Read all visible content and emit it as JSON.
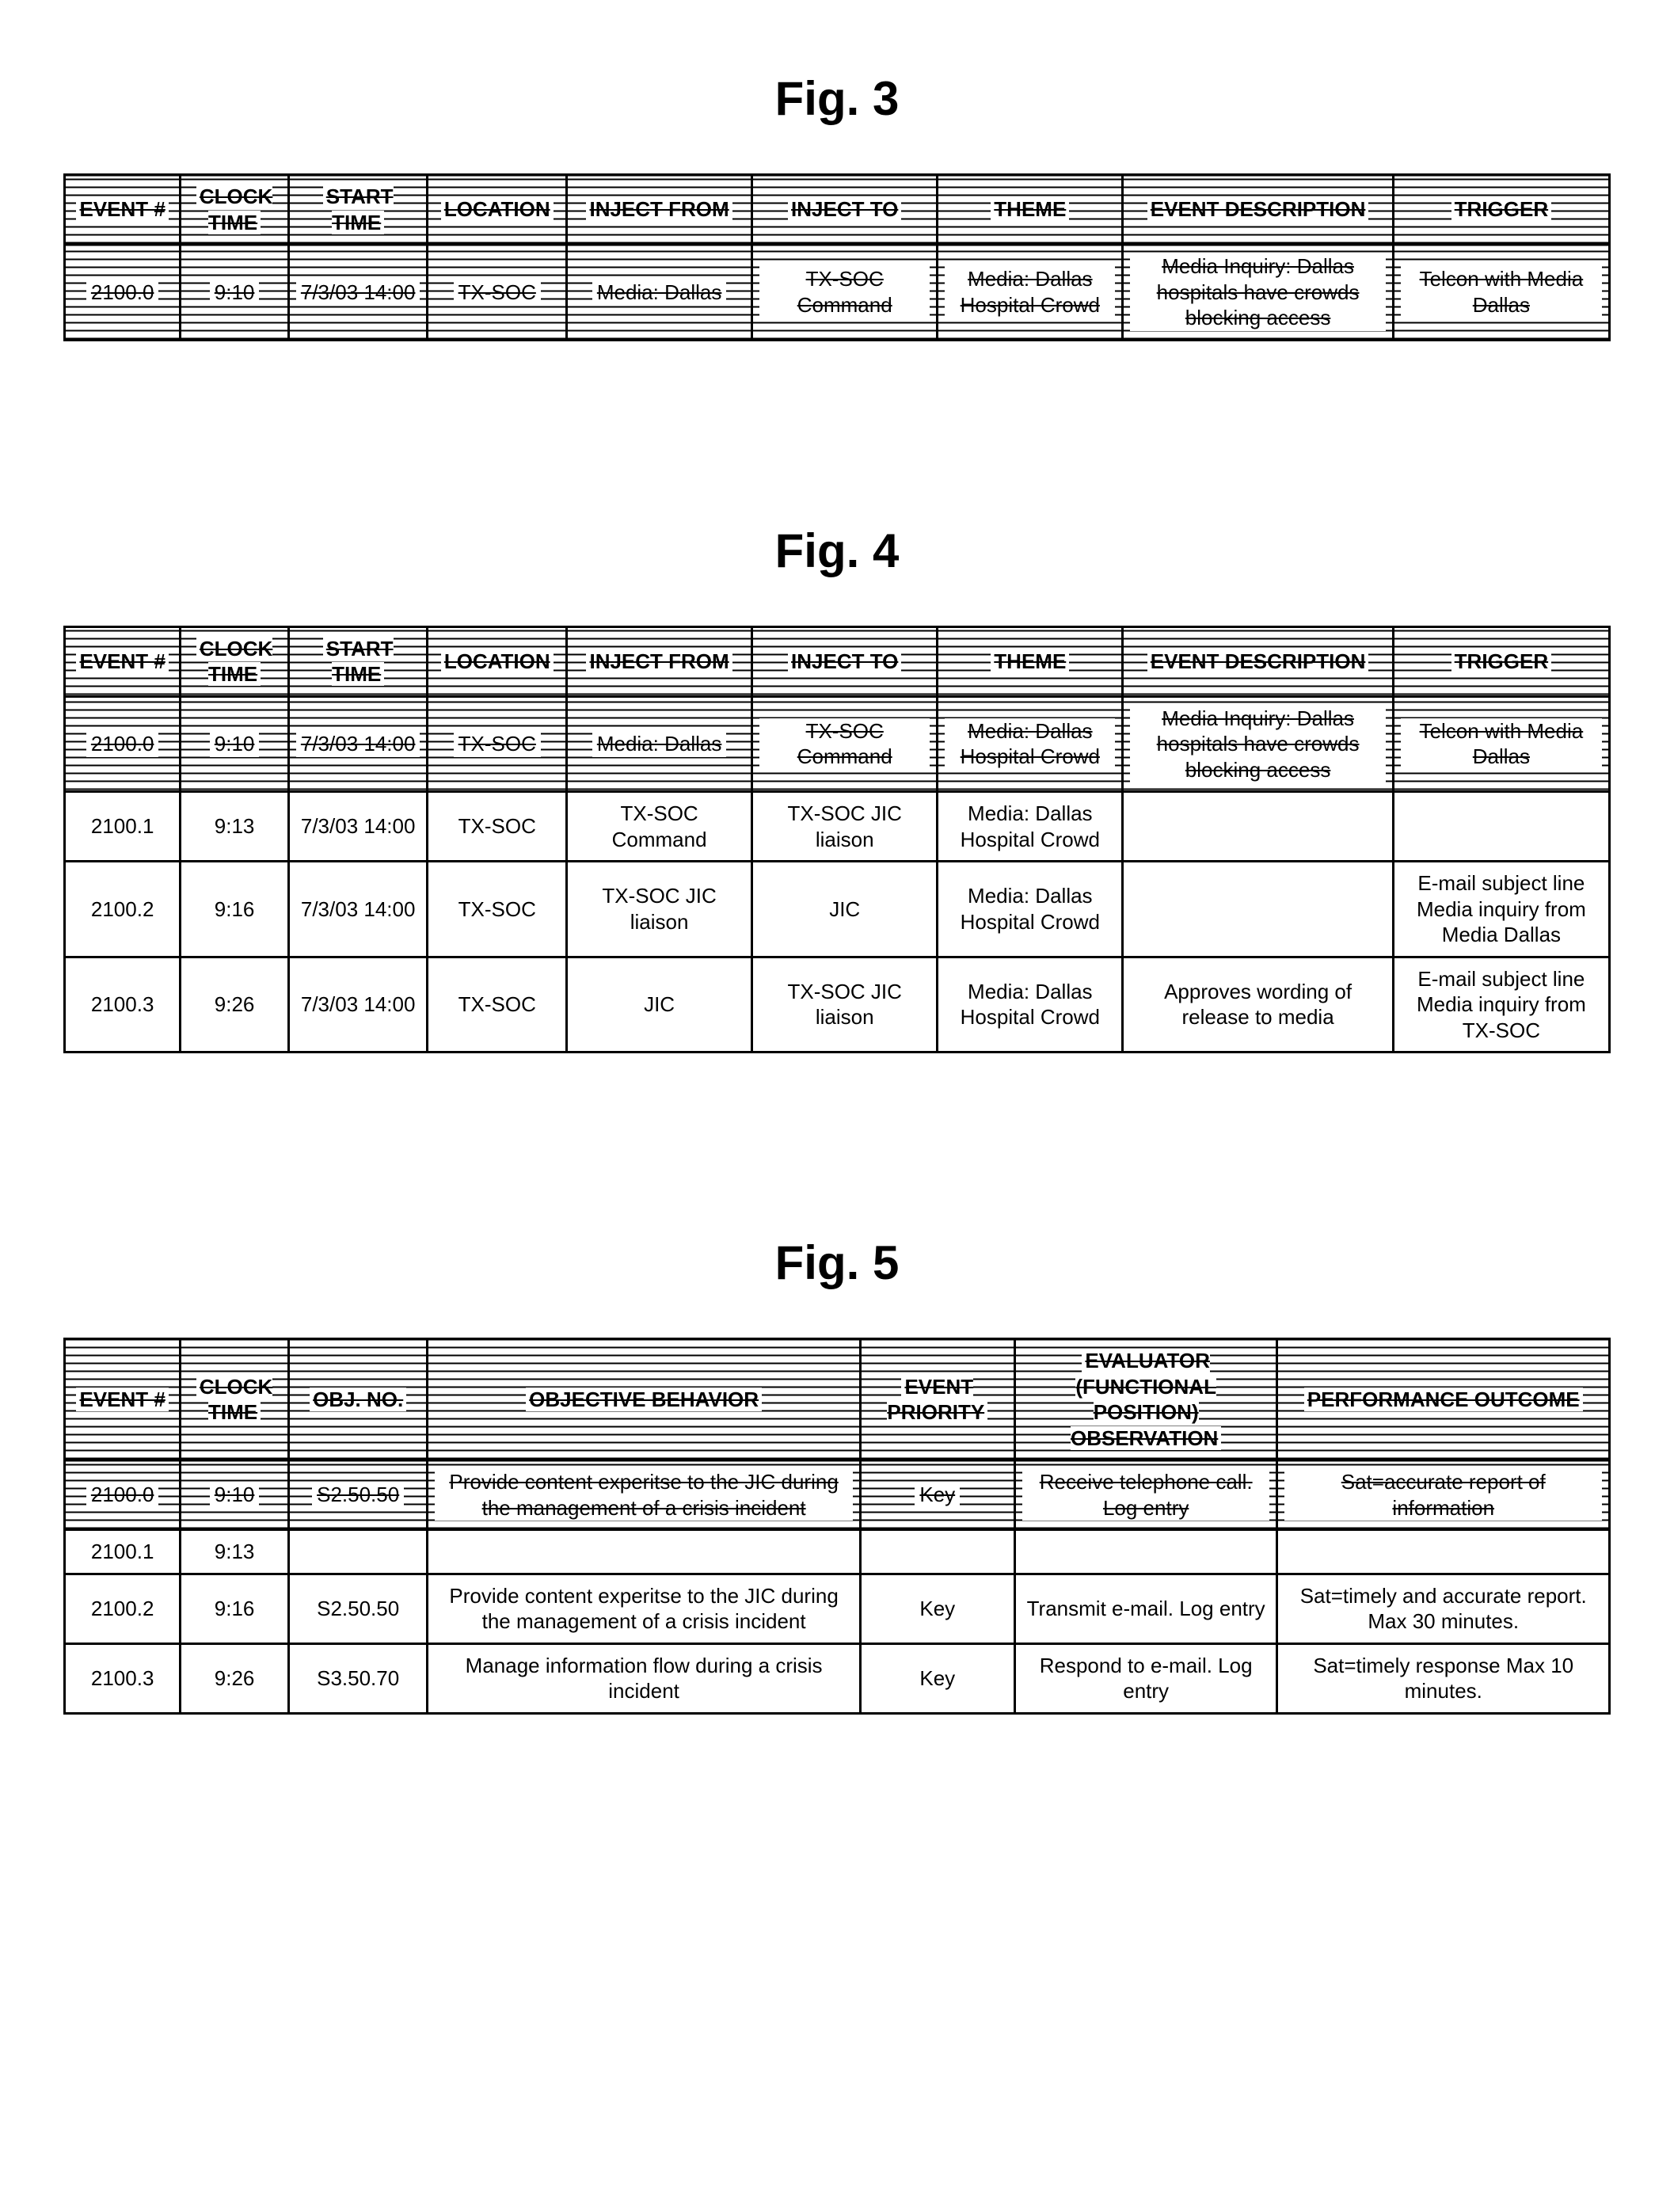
{
  "fig3": {
    "title": "Fig. 3",
    "headers": [
      "EVENT #",
      "CLOCK TIME",
      "START TIME",
      "LOCATION",
      "INJECT FROM",
      "INJECT TO",
      "THEME",
      "EVENT DESCRIPTION",
      "TRIGGER"
    ],
    "rows": [
      {
        "struck": true,
        "cells": [
          "2100.0",
          "9:10",
          "7/3/03 14:00",
          "TX-SOC",
          "Media: Dallas",
          "TX-SOC Command",
          "Media: Dallas Hospital Crowd",
          "Media Inquiry: Dallas hospitals have crowds blocking access",
          "Telcon with Media Dallas"
        ]
      }
    ]
  },
  "fig4": {
    "title": "Fig. 4",
    "headers": [
      "EVENT #",
      "CLOCK TIME",
      "START TIME",
      "LOCATION",
      "INJECT FROM",
      "INJECT TO",
      "THEME",
      "EVENT DESCRIPTION",
      "TRIGGER"
    ],
    "rows": [
      {
        "struck": true,
        "cells": [
          "2100.0",
          "9:10",
          "7/3/03 14:00",
          "TX-SOC",
          "Media: Dallas",
          "TX-SOC Command",
          "Media: Dallas Hospital Crowd",
          "Media Inquiry: Dallas hospitals have crowds blocking access",
          "Telcon with Media Dallas"
        ]
      },
      {
        "struck": false,
        "cells": [
          "2100.1",
          "9:13",
          "7/3/03 14:00",
          "TX-SOC",
          "TX-SOC Command",
          "TX-SOC JIC liaison",
          "Media: Dallas Hospital Crowd",
          "",
          ""
        ]
      },
      {
        "struck": false,
        "cells": [
          "2100.2",
          "9:16",
          "7/3/03 14:00",
          "TX-SOC",
          "TX-SOC JIC liaison",
          "JIC",
          "Media: Dallas Hospital Crowd",
          "",
          "E-mail subject line Media inquiry from Media Dallas"
        ]
      },
      {
        "struck": false,
        "cells": [
          "2100.3",
          "9:26",
          "7/3/03 14:00",
          "TX-SOC",
          "JIC",
          "TX-SOC JIC liaison",
          "Media: Dallas Hospital Crowd",
          "Approves wording of release to media",
          "E-mail subject line Media inquiry from TX-SOC"
        ]
      }
    ]
  },
  "fig5": {
    "title": "Fig. 5",
    "headers": [
      "EVENT #",
      "CLOCK TIME",
      "OBJ. NO.",
      "OBJECTIVE BEHAVIOR",
      "EVENT PRIORITY",
      "EVALUATOR (FUNCTIONAL POSITION) OBSERVATION",
      "PERFORMANCE OUTCOME"
    ],
    "rows": [
      {
        "struck": true,
        "cells": [
          "2100.0",
          "9:10",
          "S2.50.50",
          "Provide content experitse to the JIC  during the management of a crisis incident",
          "Key",
          "Receive telephone call. Log entry",
          "Sat=accurate report of information"
        ]
      },
      {
        "struck": false,
        "cells": [
          "2100.1",
          "9:13",
          "",
          "",
          "",
          "",
          ""
        ]
      },
      {
        "struck": false,
        "cells": [
          "2100.2",
          "9:16",
          "S2.50.50",
          "Provide content experitse to the JIC  during the management of a crisis incident",
          "Key",
          "Transmit e-mail. Log entry",
          "Sat=timely and accurate report. Max 30 minutes."
        ]
      },
      {
        "struck": false,
        "cells": [
          "2100.3",
          "9:26",
          "S3.50.70",
          "Manage information flow during a crisis incident",
          "Key",
          "Respond to e-mail. Log entry",
          "Sat=timely response Max 10 minutes."
        ]
      }
    ]
  }
}
